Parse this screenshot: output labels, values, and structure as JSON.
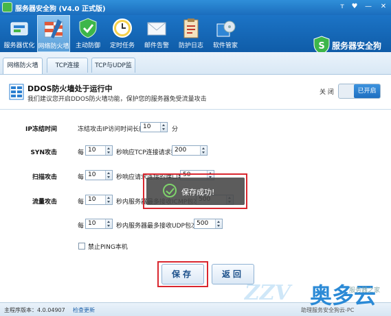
{
  "window": {
    "title": "服务器安全狗 (V4.0 正式版)",
    "controls": [
      "ᴛ",
      "♥",
      "—",
      "✕"
    ]
  },
  "toolbar": {
    "items": [
      {
        "label": "服务器优化",
        "icon": "optimize-icon"
      },
      {
        "label": "网络防火墙",
        "icon": "firewall-icon"
      },
      {
        "label": "主动防御",
        "icon": "shield-icon"
      },
      {
        "label": "定时任务",
        "icon": "clock-icon"
      },
      {
        "label": "邮件告警",
        "icon": "mail-icon"
      },
      {
        "label": "防护日志",
        "icon": "log-icon"
      },
      {
        "label": "软件管家",
        "icon": "software-icon"
      }
    ],
    "active_index": 1
  },
  "brand": {
    "name": "服务器安全狗"
  },
  "tabs": [
    {
      "label": "网络防火墙"
    },
    {
      "label": "TCP连接"
    },
    {
      "label": "TCP与UDP监听"
    }
  ],
  "status": {
    "title": "DDOS防火墙处于运行中",
    "description": "我们建议您开启DDOS防火墙功能，保护您的服务器免受流量攻击",
    "off_label": "关 闭",
    "on_label": "已开启"
  },
  "form": {
    "ip_freeze": {
      "label": "IP冻结时间",
      "prefix": "冻结攻击IP访问时间长度",
      "value": "10",
      "suffix": "分"
    },
    "syn": {
      "label": "SYN攻击",
      "prefix": "每",
      "value": "10",
      "middle": "秒响应TCP连接请求数",
      "count": "200"
    },
    "scan": {
      "label": "扫描攻击",
      "prefix": "每",
      "value": "10",
      "middle": "秒响应请求连接的端口数",
      "count": "50"
    },
    "flow_icmp": {
      "label": "流量攻击",
      "prefix": "每",
      "value": "10",
      "middle": "秒内服务器最多接收ICMP包次数",
      "count": "500"
    },
    "flow_udp": {
      "prefix": "每",
      "value": "10",
      "middle": "秒内服务器最多接收UDP包次数",
      "count": "500"
    },
    "ping": {
      "label": "禁止PING本机",
      "checked": false
    }
  },
  "buttons": {
    "save": "保存",
    "back": "返回"
  },
  "toast": {
    "text": "保存成功!"
  },
  "footer": {
    "version": "主程序版本：4.0.04907",
    "update": "检查更新",
    "hint": "助理服务安全狗云-PC"
  },
  "watermark": {
    "left": "ZZV",
    "brand": "奥多云",
    "small": "服务器之家"
  },
  "colors": {
    "accent": "#1f6fc0",
    "highlight": "#d9262e",
    "success": "#7fd36b"
  }
}
